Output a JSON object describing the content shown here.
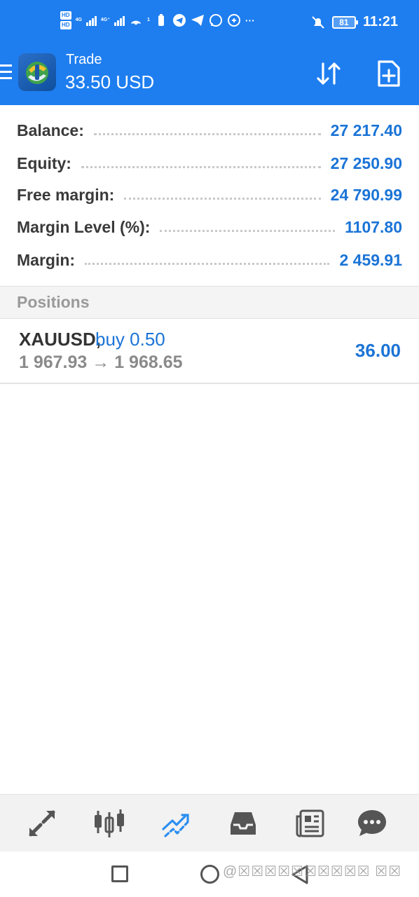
{
  "status_bar": {
    "hd1": "HD",
    "hd2": "HD",
    "sim1_label": "4G",
    "sim2_label": "4G⁺",
    "hotspot_count": "1",
    "more": "···",
    "battery": "81",
    "time": "11:21"
  },
  "app_bar": {
    "title": "Trade",
    "subtitle": "33.50 USD"
  },
  "summary": {
    "rows": [
      {
        "label": "Balance:",
        "value": "27 217.40"
      },
      {
        "label": "Equity:",
        "value": "27 250.90"
      },
      {
        "label": "Free margin:",
        "value": "24 790.99"
      },
      {
        "label": "Margin Level (%):",
        "value": "1107.80"
      },
      {
        "label": "Margin:",
        "value": "2 459.91"
      }
    ]
  },
  "positions": {
    "header": "Positions",
    "items": [
      {
        "symbol": "XAUUSD,",
        "side": "buy 0.50",
        "prices": "1 967.93 → 1 968.65",
        "profit": "36.00"
      }
    ]
  },
  "bottom_nav": {
    "items": [
      "quotes-icon",
      "chart-icon",
      "trade-icon",
      "history-icon",
      "news-icon",
      "chat-icon"
    ],
    "active": "trade-icon"
  },
  "system_nav": {
    "watermark": "@☒☒☒☒☒☒☒☒☒☒ ☒☒"
  },
  "colors": {
    "brand": "#1e7ef0",
    "value_blue": "#1b74d6",
    "label": "#3a3a3a",
    "muted": "#8a8a8a"
  }
}
